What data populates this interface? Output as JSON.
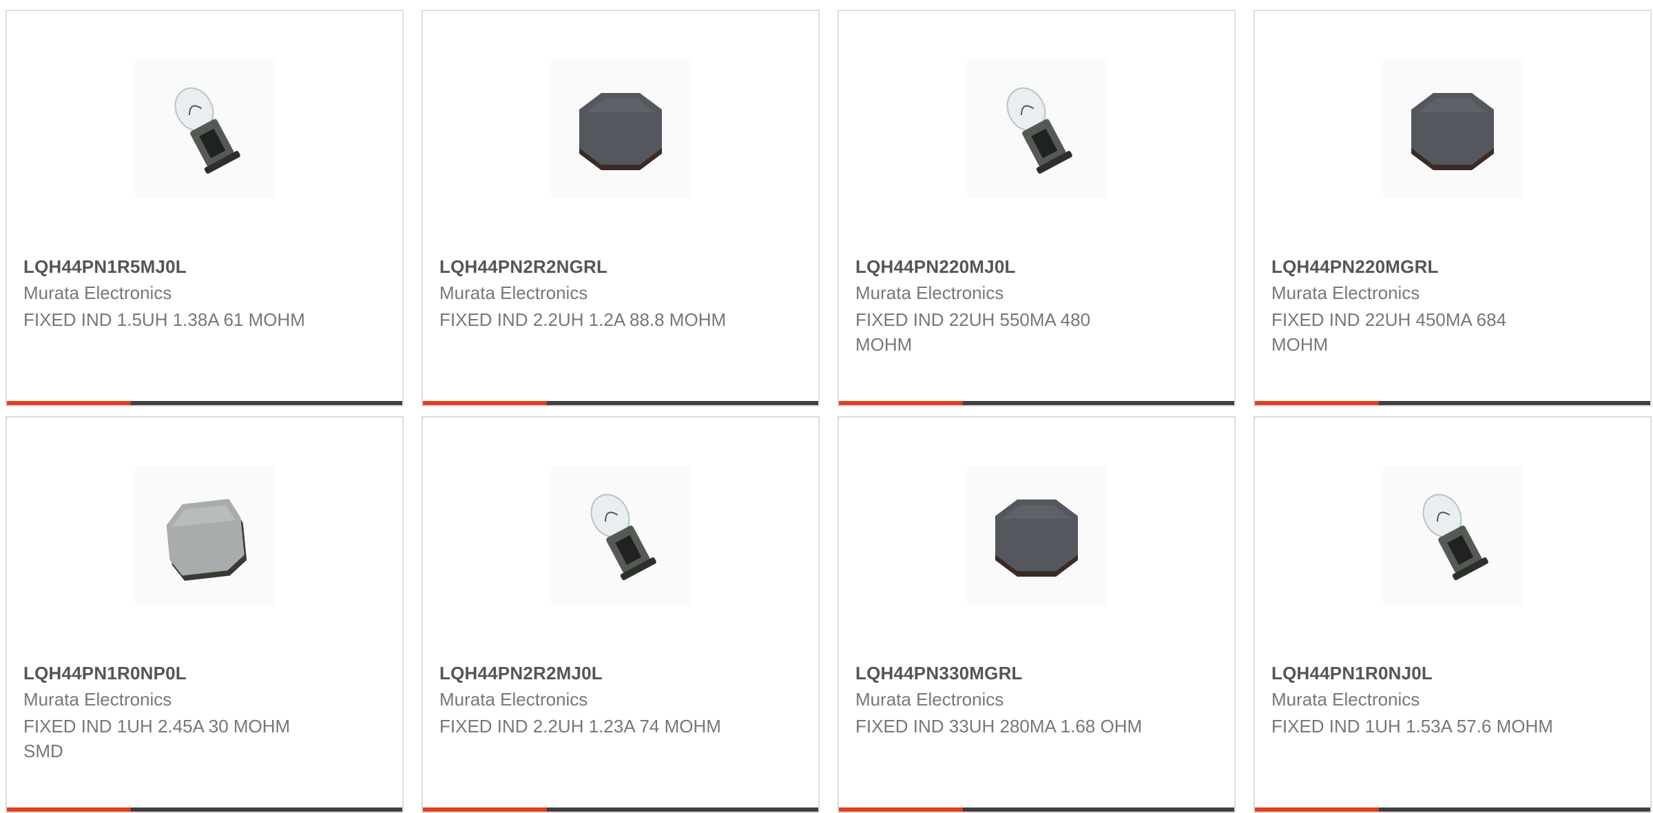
{
  "colors": {
    "accent": "#e0401b",
    "bar": "#3f3f3f",
    "border": "#dcdcdc",
    "part_number": "#555555",
    "text": "#777777"
  },
  "products": [
    {
      "part_number": "LQH44PN1R5MJ0L",
      "manufacturer": "Murata Electronics",
      "description": "FIXED IND 1.5UH 1.38A 61 MOHM",
      "image_icon": "bulb-icon"
    },
    {
      "part_number": "LQH44PN2R2NGRL",
      "manufacturer": "Murata Electronics",
      "description": "FIXED IND 2.2UH 1.2A 88.8 MOHM",
      "image_icon": "dark-inductor-icon"
    },
    {
      "part_number": "LQH44PN220MJ0L",
      "manufacturer": "Murata Electronics",
      "description": "FIXED IND 22UH 550MA 480 MOHM",
      "image_icon": "bulb-icon"
    },
    {
      "part_number": "LQH44PN220MGRL",
      "manufacturer": "Murata Electronics",
      "description": "FIXED IND 22UH 450MA 684 MOHM",
      "image_icon": "dark-inductor-icon"
    },
    {
      "part_number": "LQH44PN1R0NP0L",
      "manufacturer": "Murata Electronics",
      "description": "FIXED IND 1UH 2.45A 30 MOHM SMD",
      "image_icon": "grey-inductor-icon"
    },
    {
      "part_number": "LQH44PN2R2MJ0L",
      "manufacturer": "Murata Electronics",
      "description": "FIXED IND 2.2UH 1.23A 74 MOHM",
      "image_icon": "bulb-icon"
    },
    {
      "part_number": "LQH44PN330MGRL",
      "manufacturer": "Murata Electronics",
      "description": "FIXED IND 33UH 280MA 1.68 OHM",
      "image_icon": "dark-inductor-icon"
    },
    {
      "part_number": "LQH44PN1R0NJ0L",
      "manufacturer": "Murata Electronics",
      "description": "FIXED IND 1UH 1.53A 57.6 MOHM",
      "image_icon": "bulb-icon"
    }
  ]
}
